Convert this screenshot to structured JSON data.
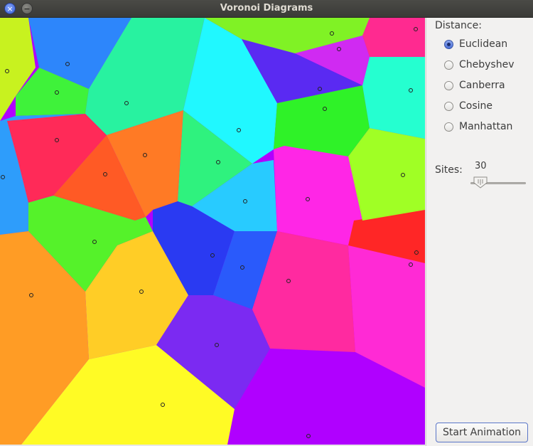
{
  "window": {
    "title": "Voronoi Diagrams"
  },
  "panel": {
    "distance_label": "Distance:",
    "distance_options": [
      "Euclidean",
      "Chebyshev",
      "Canberra",
      "Cosine",
      "Manhattan"
    ],
    "selected_distance": "Euclidean",
    "sites_label": "Sites:",
    "sites_value": "30",
    "start_button": "Start Animation"
  },
  "canvas": {
    "site_count": 30
  }
}
